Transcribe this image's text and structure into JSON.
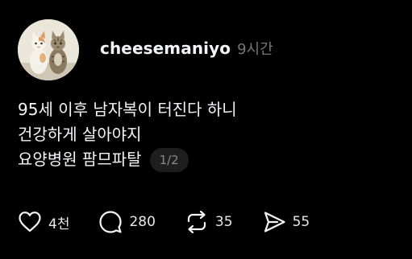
{
  "post": {
    "author": {
      "username": "cheesemaniyo",
      "avatar_icon": "two-cats-avatar"
    },
    "time_ago": "9시간",
    "lines": [
      "95세 이후 남자복이 터진다 하니",
      "건강하게 살아야지",
      "요양병원 팜므파탈"
    ],
    "page_indicator": "1/2",
    "actions": {
      "like": {
        "icon": "heart-icon",
        "count": "4천"
      },
      "comment": {
        "icon": "comment-icon",
        "count": "280"
      },
      "repost": {
        "icon": "repost-icon",
        "count": "35"
      },
      "share": {
        "icon": "send-icon",
        "count": "55"
      }
    }
  },
  "colors": {
    "background": "#000000",
    "text": "#f3f5f7",
    "muted": "#777777",
    "pill": "#1e1e1e"
  }
}
